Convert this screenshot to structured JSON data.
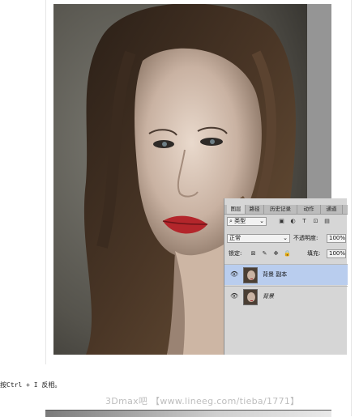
{
  "panel": {
    "tabs": [
      "图层",
      "路径",
      "历史记录",
      "动作",
      "通道"
    ],
    "filter": {
      "label": "类型",
      "icon": "search-icon"
    },
    "filter_icons": [
      "image-filter-icon",
      "adjustment-filter-icon",
      "text-filter-icon",
      "shape-filter-icon",
      "smart-object-filter-icon"
    ],
    "blend_mode": "正常",
    "opacity_label": "不透明度:",
    "opacity_value": "100%",
    "lock_label": "锁定:",
    "lock_icons": [
      "lock-transparent-icon",
      "lock-image-icon",
      "lock-position-icon",
      "lock-all-icon"
    ],
    "fill_label": "填充:",
    "fill_value": "100%",
    "layers": [
      {
        "name": "背景 副本",
        "selected": true,
        "visible": true
      },
      {
        "name": "背景",
        "selected": false,
        "visible": true
      }
    ]
  },
  "caption": "按Ctrl + I 反相。",
  "watermark": "3Dmax吧 【www.lineeg.com/tieba/1771】"
}
